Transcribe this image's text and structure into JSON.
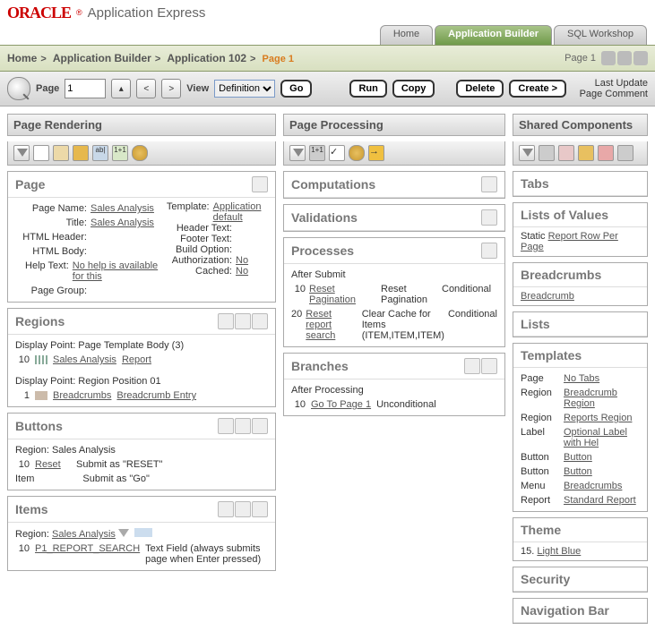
{
  "logo": {
    "brand": "ORACLE",
    "reg": "®",
    "product": "Application Express"
  },
  "navTabs": {
    "home": "Home",
    "appBuilder": "Application Builder",
    "sqlWorkshop": "SQL Workshop"
  },
  "breadcrumb": {
    "home": "Home",
    "appBuilder": "Application Builder",
    "app": "Application 102",
    "page": "Page 1",
    "rightLabel": "Page 1"
  },
  "toolbar": {
    "pageLabel": "Page",
    "pageValue": "1",
    "viewLabel": "View",
    "viewValue": "Definition",
    "go": "Go",
    "run": "Run",
    "copy": "Copy",
    "delete": "Delete",
    "create": "Create >",
    "link1": "Last Update",
    "link2": "Page Comment"
  },
  "colHeads": {
    "render": "Page Rendering",
    "process": "Page Processing",
    "shared": "Shared Components"
  },
  "page": {
    "title": "Page",
    "nameLabel": "Page Name:",
    "nameVal": "Sales Analysis",
    "titleLabel": "Title:",
    "titleVal": "Sales Analysis",
    "htmlHeaderLabel": "HTML Header:",
    "htmlBodyLabel": "HTML Body:",
    "helpLabel": "Help Text:",
    "helpVal": "No help is available for this",
    "groupLabel": "Page Group:",
    "templateLabel": "Template:",
    "templateVal": "Application default",
    "headerTextLabel": "Header Text:",
    "footerTextLabel": "Footer Text:",
    "buildLabel": "Build Option:",
    "authLabel": "Authorization:",
    "authVal": "No",
    "cachedLabel": "Cached:",
    "cachedVal": "No"
  },
  "regions": {
    "title": "Regions",
    "dp1": "Display Point: Page Template Body (3)",
    "r1seq": "10",
    "r1a": "Sales Analysis",
    "r1b": "Report",
    "dp2": "Display Point: Region Position 01",
    "r2seq": "1",
    "r2a": "Breadcrumbs",
    "r2b": "Breadcrumb Entry"
  },
  "buttons": {
    "title": "Buttons",
    "regionLabel": "Region: Sales Analysis",
    "b1seq": "10",
    "b1name": "Reset",
    "b1desc": "Submit as \"RESET\"",
    "b2seq": "Item",
    "b2desc": "Submit as \"Go\""
  },
  "items": {
    "title": "Items",
    "regionLabel": "Region:",
    "regionLink": "Sales Analysis",
    "i1seq": "10",
    "i1name": "P1_REPORT_SEARCH",
    "i1desc": "Text Field (always submits page when Enter pressed)"
  },
  "comp": {
    "title": "Computations"
  },
  "val": {
    "title": "Validations"
  },
  "proc": {
    "title": "Processes",
    "sub": "After Submit",
    "p1seq": "10",
    "p1link": "Reset Pagination",
    "p1desc": "Reset Pagination",
    "p1cond": "Conditional",
    "p2seq": "20",
    "p2link": "Reset report search",
    "p2desc": "Clear Cache for Items (ITEM,ITEM,ITEM)",
    "p2cond": "Conditional"
  },
  "branch": {
    "title": "Branches",
    "sub": "After Processing",
    "b1seq": "10",
    "b1link": "Go To Page 1",
    "b1desc": "Unconditional"
  },
  "tabs": {
    "title": "Tabs"
  },
  "lov": {
    "title": "Lists of Values",
    "staticLabel": "Static",
    "link": "Report Row Per Page"
  },
  "bcPanel": {
    "title": "Breadcrumbs",
    "link": "Breadcrumb"
  },
  "lists": {
    "title": "Lists"
  },
  "tmpl": {
    "title": "Templates",
    "rows": [
      {
        "t": "Page",
        "v": "No Tabs"
      },
      {
        "t": "Region",
        "v": "Breadcrumb Region"
      },
      {
        "t": "Region",
        "v": "Reports Region"
      },
      {
        "t": "Label",
        "v": "Optional Label with Hel"
      },
      {
        "t": "Button",
        "v": "Button"
      },
      {
        "t": "Button",
        "v": "Button"
      },
      {
        "t": "Menu",
        "v": "Breadcrumbs"
      },
      {
        "t": "Report",
        "v": "Standard Report"
      }
    ]
  },
  "theme": {
    "title": "Theme",
    "num": "15.",
    "link": "Light Blue"
  },
  "sec": {
    "title": "Security"
  },
  "navbar": {
    "title": "Navigation Bar"
  }
}
